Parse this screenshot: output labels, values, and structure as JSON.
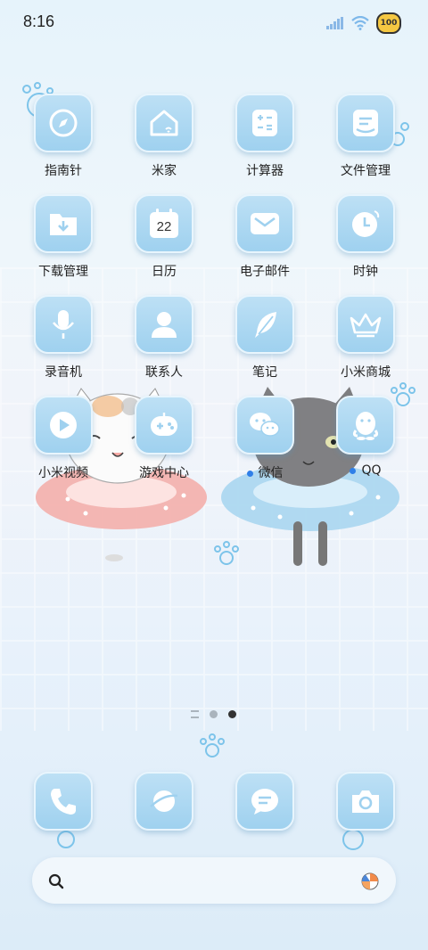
{
  "status_bar": {
    "time": "8:16",
    "battery": "100"
  },
  "apps": [
    {
      "label": "指南针",
      "icon": "compass-icon"
    },
    {
      "label": "米家",
      "icon": "smart-home-icon"
    },
    {
      "label": "计算器",
      "icon": "calculator-icon"
    },
    {
      "label": "文件管理",
      "icon": "file-manager-icon"
    },
    {
      "label": "下载管理",
      "icon": "download-folder-icon"
    },
    {
      "label": "日历",
      "icon": "calendar-icon",
      "date": "22"
    },
    {
      "label": "电子邮件",
      "icon": "mail-icon"
    },
    {
      "label": "时钟",
      "icon": "clock-icon"
    },
    {
      "label": "录音机",
      "icon": "microphone-icon"
    },
    {
      "label": "联系人",
      "icon": "contact-person-icon"
    },
    {
      "label": "笔记",
      "icon": "feather-note-icon"
    },
    {
      "label": "小米商城",
      "icon": "crown-store-icon"
    },
    {
      "label": "小米视频",
      "icon": "play-video-icon"
    },
    {
      "label": "游戏中心",
      "icon": "gamepad-icon"
    },
    {
      "label": "微信",
      "icon": "wechat-icon",
      "new_badge": true
    },
    {
      "label": "QQ",
      "icon": "qq-penguin-icon",
      "new_badge": true
    }
  ],
  "dock": [
    {
      "name": "phone",
      "icon": "phone-icon"
    },
    {
      "name": "browser",
      "icon": "planet-browser-icon"
    },
    {
      "name": "messages",
      "icon": "message-bubble-icon"
    },
    {
      "name": "camera",
      "icon": "camera-icon"
    }
  ],
  "search": {
    "icon": "search-icon",
    "right_icon": "beach-ball-icon"
  },
  "colors": {
    "tile": "#a9d7f1",
    "glyph": "#ffffff",
    "badge": "#2f7fe8",
    "label": "#222222"
  }
}
